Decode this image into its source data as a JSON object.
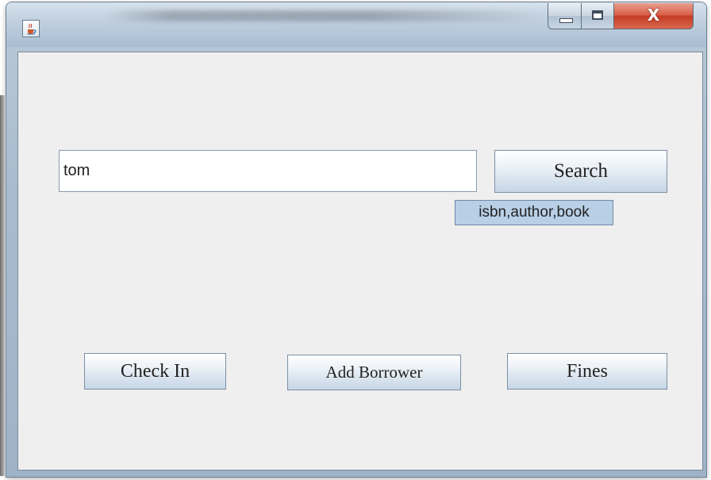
{
  "window": {
    "controls": {
      "minimize_icon": "minimize-icon",
      "maximize_icon": "maximize-icon",
      "close_glyph": "X"
    },
    "app_icon": "java-cup-icon"
  },
  "search": {
    "value": "tom",
    "button_label": "Search",
    "tooltip": "isbn,author,book"
  },
  "actions": {
    "check_in_label": "Check In",
    "add_borrower_label": "Add Borrower",
    "fines_label": "Fines"
  },
  "colors": {
    "client_bg": "#efefef",
    "tooltip_bg": "#b8cfe5",
    "close_button": "#c43d24"
  }
}
